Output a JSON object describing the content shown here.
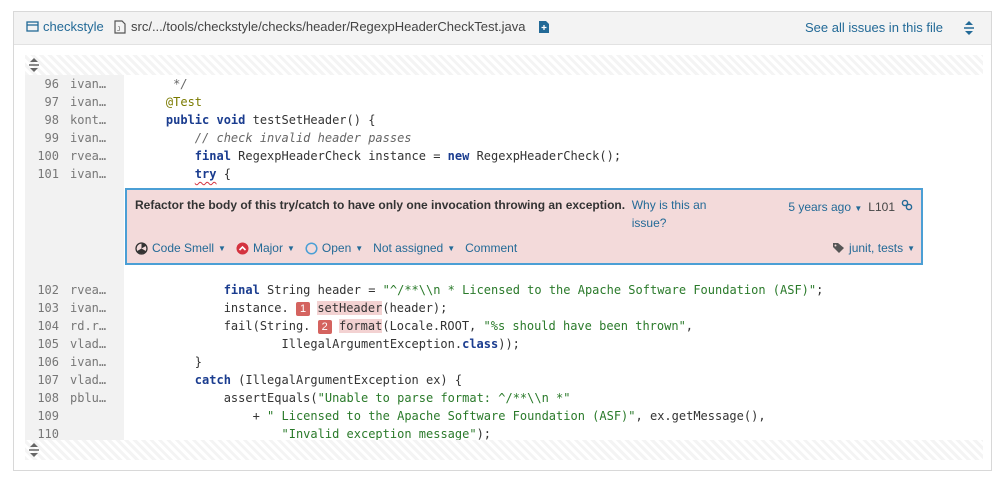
{
  "header": {
    "project": "checkstyle",
    "path": "src/.../tools/checkstyle/checks/header/RegexpHeaderCheckTest.java",
    "see_all": "See all issues in this file"
  },
  "lines_top": [
    {
      "n": "96",
      "a": "ivan…",
      "code": [
        {
          "t": "     */",
          "c": "cm"
        }
      ]
    },
    {
      "n": "97",
      "a": "ivan…",
      "code": [
        {
          "t": "    ",
          "c": ""
        },
        {
          "t": "@Test",
          "c": "an"
        }
      ]
    },
    {
      "n": "98",
      "a": "kont…",
      "code": [
        {
          "t": "    ",
          "c": ""
        },
        {
          "t": "public void",
          "c": "kw"
        },
        {
          "t": " testSetHeader() {",
          "c": ""
        }
      ]
    },
    {
      "n": "99",
      "a": "ivan…",
      "code": [
        {
          "t": "        ",
          "c": ""
        },
        {
          "t": "// check invalid header passes",
          "c": "cm"
        }
      ]
    },
    {
      "n": "100",
      "a": "rvea…",
      "code": [
        {
          "t": "        ",
          "c": ""
        },
        {
          "t": "final",
          "c": "kw"
        },
        {
          "t": " RegexpHeaderCheck instance = ",
          "c": ""
        },
        {
          "t": "new",
          "c": "kw"
        },
        {
          "t": " RegexpHeaderCheck();",
          "c": ""
        }
      ]
    },
    {
      "n": "101",
      "a": "ivan…",
      "code": [
        {
          "t": "        ",
          "c": ""
        },
        {
          "t": "try",
          "c": "kw squig"
        },
        {
          "t": " {",
          "c": ""
        }
      ]
    }
  ],
  "issue": {
    "message": "Refactor the body of this try/catch to have only one invocation throwing an exception.",
    "why": "Why is this an issue?",
    "age": "5 years ago",
    "line": "L101",
    "type": "Code Smell",
    "severity": "Major",
    "status": "Open",
    "assignee": "Not assigned",
    "comment": "Comment",
    "tags": "junit, tests"
  },
  "lines_bottom": [
    {
      "n": "102",
      "a": "rvea…",
      "code": [
        {
          "t": "            ",
          "c": ""
        },
        {
          "t": "final",
          "c": "kw"
        },
        {
          "t": " String header = ",
          "c": ""
        },
        {
          "t": "\"^/**\\\\n * Licensed to the Apache Software Foundation (ASF)\"",
          "c": "str"
        },
        {
          "t": ";",
          "c": ""
        }
      ]
    },
    {
      "n": "103",
      "a": "ivan…",
      "code": [
        {
          "t": "            instance. ",
          "c": ""
        },
        {
          "t": "1",
          "c": "loc"
        },
        {
          "t": " ",
          "c": ""
        },
        {
          "t": "setHeader",
          "c": "hl"
        },
        {
          "t": "(header);",
          "c": ""
        }
      ]
    },
    {
      "n": "104",
      "a": "rd.r…",
      "code": [
        {
          "t": "            fail(String. ",
          "c": ""
        },
        {
          "t": "2",
          "c": "loc"
        },
        {
          "t": " ",
          "c": ""
        },
        {
          "t": "format",
          "c": "hl"
        },
        {
          "t": "(Locale.ROOT, ",
          "c": ""
        },
        {
          "t": "\"%s should have been thrown\"",
          "c": "str"
        },
        {
          "t": ",",
          "c": ""
        }
      ]
    },
    {
      "n": "105",
      "a": "vlad…",
      "code": [
        {
          "t": "                    IllegalArgumentException.",
          "c": ""
        },
        {
          "t": "class",
          "c": "kw"
        },
        {
          "t": "));",
          "c": ""
        }
      ]
    },
    {
      "n": "106",
      "a": "ivan…",
      "code": [
        {
          "t": "        }",
          "c": ""
        }
      ]
    },
    {
      "n": "107",
      "a": "vlad…",
      "code": [
        {
          "t": "        ",
          "c": ""
        },
        {
          "t": "catch",
          "c": "kw"
        },
        {
          "t": " (IllegalArgumentException ex) {",
          "c": ""
        }
      ]
    },
    {
      "n": "108",
      "a": "pblu…",
      "code": [
        {
          "t": "            assertEquals(",
          "c": ""
        },
        {
          "t": "\"Unable to parse format: ^/**\\\\n *\"",
          "c": "str"
        }
      ]
    },
    {
      "n": "109",
      "a": "",
      "code": [
        {
          "t": "                + ",
          "c": ""
        },
        {
          "t": "\" Licensed to the Apache Software Foundation (ASF)\"",
          "c": "str"
        },
        {
          "t": ", ex.getMessage(),",
          "c": ""
        }
      ]
    },
    {
      "n": "110",
      "a": "",
      "code": [
        {
          "t": "                    ",
          "c": ""
        },
        {
          "t": "\"Invalid exception message\"",
          "c": "str"
        },
        {
          "t": ");",
          "c": ""
        }
      ]
    }
  ],
  "colors": {
    "link": "#236a97",
    "issue_bg": "#f3dada",
    "issue_border": "#4b9fd5",
    "location": "#d4635f"
  }
}
